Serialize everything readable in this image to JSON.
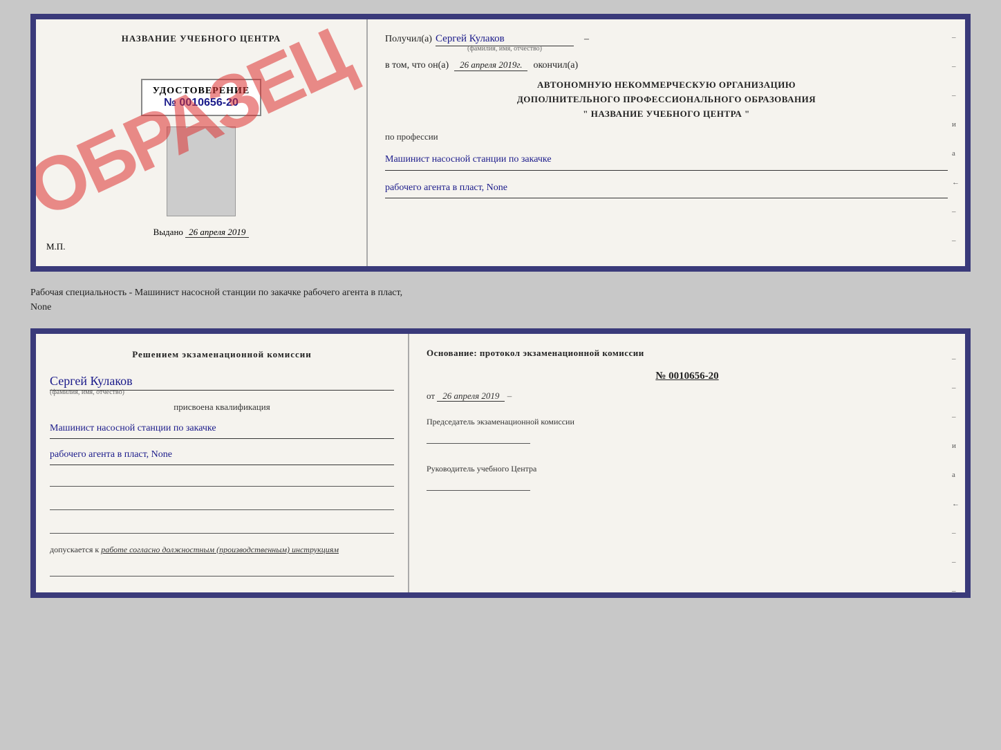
{
  "top_cert": {
    "left": {
      "school_name": "НАЗВАНИЕ УЧЕБНОГО ЦЕНТРА",
      "obrazets": "ОБРАЗЕЦ",
      "udost_title": "УДОСТОВЕРЕНИЕ",
      "udost_number": "№ 0010656-20",
      "vydano_label": "Выдано",
      "vydano_date": "26 апреля 2019",
      "mp_label": "М.П."
    },
    "right": {
      "poluchil_label": "Получил(а)",
      "poluchil_value": "Сергей Кулаков",
      "fio_hint": "(фамилия, имя, отчество)",
      "vtom_label": "в том, что он(а)",
      "vtom_date": "26 апреля 2019г.",
      "okonchil_label": "окончил(а)",
      "org_line1": "АВТОНОМНУЮ НЕКОММЕРЧЕСКУЮ ОРГАНИЗАЦИЮ",
      "org_line2": "ДОПОЛНИТЕЛЬНОГО ПРОФЕССИОНАЛЬНОГО ОБРАЗОВАНИЯ",
      "org_line3": "\"  НАЗВАНИЕ УЧЕБНОГО ЦЕНТРА  \"",
      "po_professii": "по профессии",
      "profession_line1": "Машинист насосной станции по закачке",
      "profession_line2": "рабочего агента в пласт, None",
      "side_marks": [
        "-",
        "-",
        "-",
        "и",
        "а",
        "←",
        "-",
        "-",
        "-"
      ]
    }
  },
  "info_text": {
    "line1": "Рабочая специальность - Машинист насосной станции по закачке рабочего агента в пласт,",
    "line2": "None"
  },
  "bottom_cert": {
    "left": {
      "komissia_title": "Решением экзаменационной комиссии",
      "name_value": "Сергей Кулаков",
      "fio_hint": "(фамилия, имя, отчество)",
      "prisvoena": "присвоена квалификация",
      "qual_line1": "Машинист насосной станции по закачке",
      "qual_line2": "рабочего агента в пласт, None",
      "dopuskaetsya_prefix": "допускается к",
      "dopuskaetsya_value": "работе согласно должностным (производственным) инструкциям"
    },
    "right": {
      "osnov_label": "Основание: протокол экзаменационной комиссии",
      "protocol_num": "№ 0010656-20",
      "ot_label": "от",
      "ot_date": "26 апреля 2019",
      "predsedatel_label": "Председатель экзаменационной комиссии",
      "rukovoditel_label": "Руководитель учебного Центра",
      "side_marks": [
        "-",
        "-",
        "-",
        "и",
        "а",
        "←",
        "-",
        "-",
        "-"
      ]
    }
  }
}
